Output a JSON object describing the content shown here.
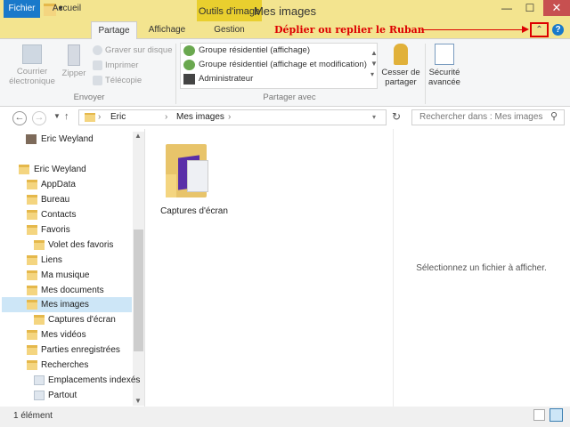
{
  "window": {
    "title": "Mes images",
    "contextual_tab": "Outils d'image"
  },
  "ribbon_tabs": [
    "Fichier",
    "Accueil",
    "Partage",
    "Affichage",
    "Gestion"
  ],
  "annotation": "Déplier ou replier le Ruban",
  "ribbon": {
    "envoyer": {
      "courrier": "Courrier électronique",
      "zipper": "Zipper",
      "graver": "Graver sur disque",
      "imprimer": "Imprimer",
      "telecopie": "Télécopie",
      "label": "Envoyer"
    },
    "partager_avec": {
      "items": [
        "Groupe résidentiel (affichage)",
        "Groupe résidentiel (affichage et modification)",
        "Administrateur"
      ],
      "cesser": "Cesser de partager",
      "label": "Partager avec"
    },
    "securite": "Sécurité avancée"
  },
  "address": {
    "crumb1": "Eric",
    "crumb2": "Mes images",
    "search_placeholder": "Rechercher dans : Mes images"
  },
  "nav": {
    "user_top": "Eric Weyland",
    "user": "Eric Weyland",
    "items": [
      "AppData",
      "Bureau",
      "Contacts",
      "Favoris",
      "Volet des favoris",
      "Liens",
      "Ma musique",
      "Mes documents",
      "Mes images",
      "Captures d'écran",
      "Mes vidéos",
      "Parties enregistrées",
      "Recherches",
      "Emplacements indexés",
      "Partout"
    ]
  },
  "files": [
    {
      "name": "Captures d'écran"
    }
  ],
  "preview": {
    "message": "Sélectionnez un fichier à afficher."
  },
  "status": {
    "count": "1 élément"
  },
  "colors": {
    "title_bar": "#f3e48f",
    "file_tab": "#1979ca",
    "annotation": "#dd0000",
    "selection": "#cde6f7"
  }
}
